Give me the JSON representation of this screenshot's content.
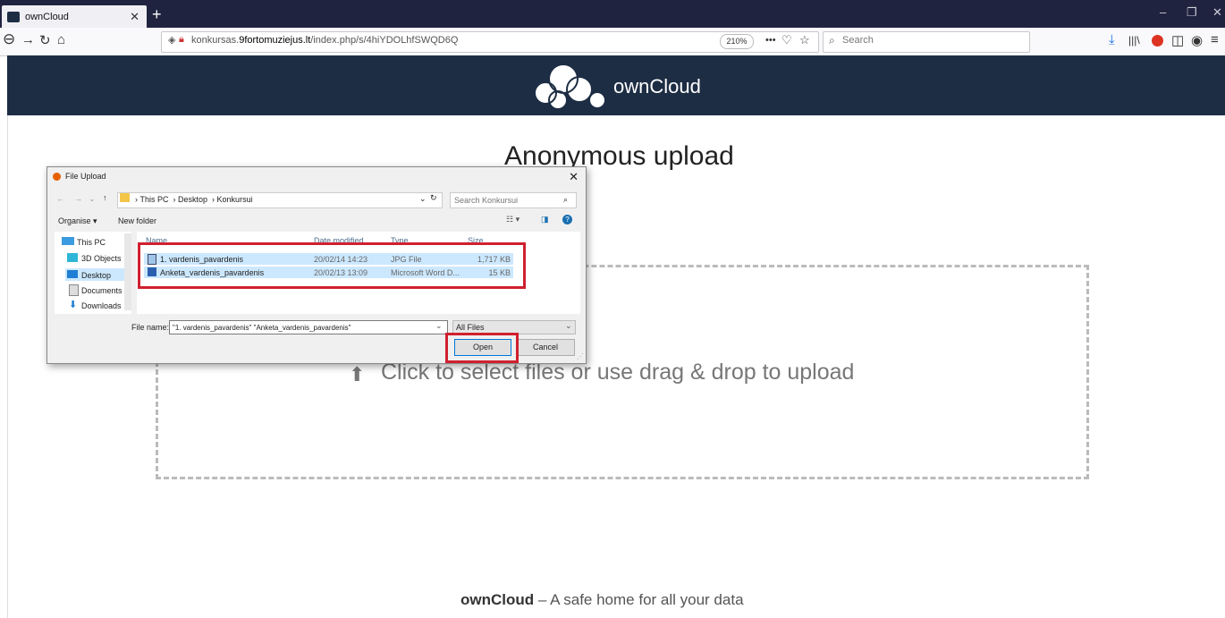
{
  "browser": {
    "tab_title": "ownCloud",
    "url_domain": "konkursas.",
    "url_host": "9fortomuziejus.lt",
    "url_path": "/index.php/s/4hiYDOLhfSWQD6Q",
    "zoom": "210%",
    "search_placeholder": "Search",
    "more_glyph": "•••"
  },
  "page": {
    "brand": "ownCloud",
    "heading": "Anonymous upload",
    "drop_text": "Click to select files or use drag & drop to upload",
    "footer_brand": "ownCloud",
    "footer_text": " – A safe home for all your data"
  },
  "dialog": {
    "title": "File Upload",
    "breadcrumb": [
      "This PC",
      "Desktop",
      "Konkursui"
    ],
    "search_placeholder": "Search Konkursui",
    "organise": "Organise ▾",
    "new_folder": "New folder",
    "nav": [
      "This PC",
      "3D Objects",
      "Desktop",
      "Documents",
      "Downloads"
    ],
    "columns": [
      "Name",
      "Date modified",
      "Type",
      "Size"
    ],
    "files": [
      {
        "name": "1. vardenis_pavardenis",
        "date": "20/02/14 14:23",
        "type": "JPG File",
        "size": "1,717 KB"
      },
      {
        "name": "Anketa_vardenis_pavardenis",
        "date": "20/02/13 13:09",
        "type": "Microsoft Word D...",
        "size": "15 KB"
      }
    ],
    "filename_label": "File name:",
    "filename_value": "\"1. vardenis_pavardenis\" \"Anketa_vardenis_pavardenis\"",
    "filetype": "All Files",
    "open": "Open",
    "cancel": "Cancel"
  },
  "colors": {
    "header": "#1d2d44",
    "highlight": "#d0202f",
    "selection": "#cce8ff"
  }
}
